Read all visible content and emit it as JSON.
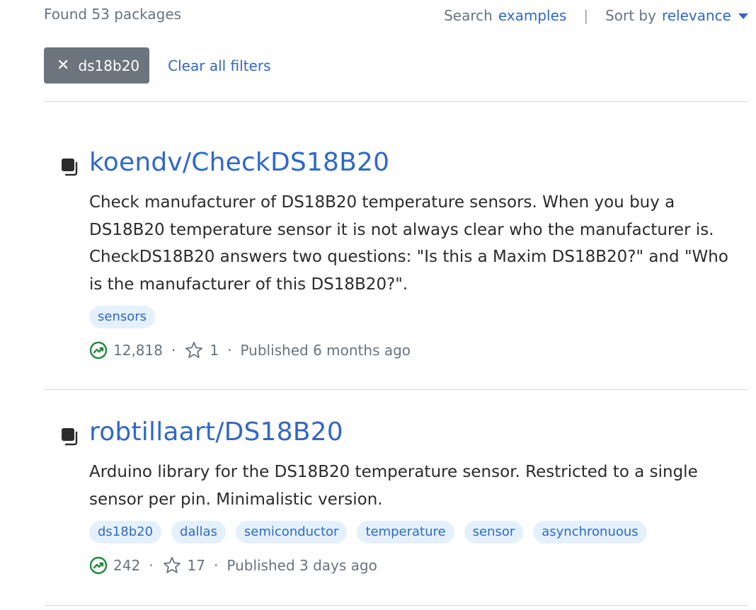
{
  "header": {
    "found_text": "Found 53 packages",
    "search_label": "Search",
    "search_link": "examples",
    "divider": "|",
    "sort_label": "Sort by",
    "sort_value": "relevance"
  },
  "filters": {
    "chip_label": "ds18b20",
    "clear_label": "Clear all filters"
  },
  "colors": {
    "link": "#3068c8",
    "chip_bg": "#6c757d",
    "tag_bg": "#e4f1fc",
    "trend_icon": "#1f8a3a"
  },
  "packages": [
    {
      "title": "koendv/CheckDS18B20",
      "description": "Check manufacturer of DS18B20 temperature sensors. When you buy a DS18B20 temperature sensor it is not always clear who the manufacturer is. CheckDS18B20 answers two questions: \"Is this a Maxim DS18B20?\" and \"Who is the manufacturer of this DS18B20?\".",
      "tags": [
        "sensors"
      ],
      "downloads": "12,818",
      "stars": "1",
      "published": "Published 6 months ago"
    },
    {
      "title": "robtillaart/DS18B20",
      "description": "Arduino library for the DS18B20 temperature sensor. Restricted to a single sensor per pin. Minimalistic version.",
      "tags": [
        "ds18b20",
        "dallas",
        "semiconductor",
        "temperature",
        "sensor",
        "asynchronuous"
      ],
      "downloads": "242",
      "stars": "17",
      "published": "Published 3 days ago"
    }
  ],
  "meta_separator": "·"
}
